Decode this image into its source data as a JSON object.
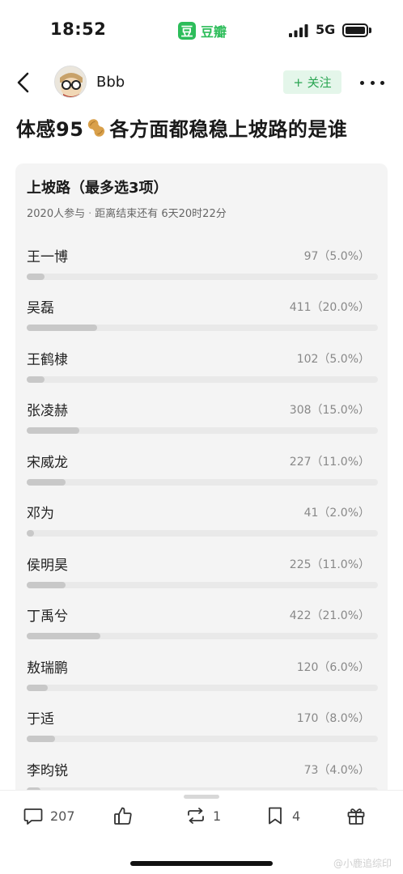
{
  "status_bar": {
    "time": "18:52",
    "app_logo_char": "豆",
    "app_name": "豆瓣",
    "network": "5G"
  },
  "nav": {
    "username": "Bbb",
    "follow_label": "+ 关注"
  },
  "post": {
    "title_part1": "体感95",
    "title_part2": "各方面都稳稳上坡路的是谁",
    "title_emoji_icon": "peanut-icon"
  },
  "poll": {
    "title": "上坡路（最多选3项）",
    "participants": "2020人参与",
    "deadline": "距离结束还有 6天20时22分",
    "options": [
      {
        "name": "王一博",
        "count": "97（5.0%）",
        "percent": 5.0
      },
      {
        "name": "吴磊",
        "count": "411（20.0%）",
        "percent": 20.0
      },
      {
        "name": "王鹤棣",
        "count": "102（5.0%）",
        "percent": 5.0
      },
      {
        "name": "张凌赫",
        "count": "308（15.0%）",
        "percent": 15.0
      },
      {
        "name": "宋威龙",
        "count": "227（11.0%）",
        "percent": 11.0
      },
      {
        "name": "邓为",
        "count": "41（2.0%）",
        "percent": 2.0
      },
      {
        "name": "侯明昊",
        "count": "225（11.0%）",
        "percent": 11.0
      },
      {
        "name": "丁禹兮",
        "count": "422（21.0%）",
        "percent": 21.0
      },
      {
        "name": "敖瑞鹏",
        "count": "120（6.0%）",
        "percent": 6.0
      },
      {
        "name": "于适",
        "count": "170（8.0%）",
        "percent": 8.0
      },
      {
        "name": "李昀锐",
        "count": "73（4.0%）",
        "percent": 4.0
      }
    ]
  },
  "actions": {
    "comments": "207",
    "reshares": "1",
    "collects": "4"
  },
  "watermark": "@小鹿追综印",
  "colors": {
    "accent_green": "#2dbd5a",
    "follow_bg": "#e4f6ea",
    "poll_bg": "#f4f4f4",
    "bar_fill": "#c8c8c8",
    "bar_track": "#e9e9e9"
  }
}
